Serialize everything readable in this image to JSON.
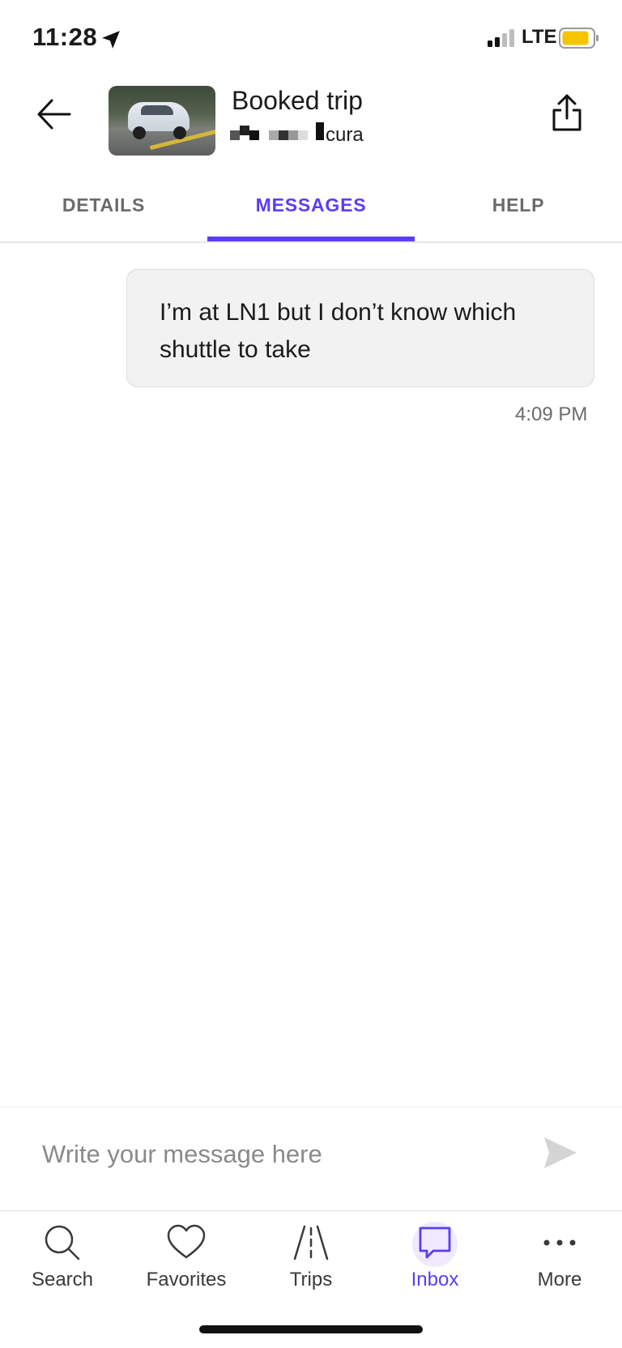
{
  "status_bar": {
    "time": "11:28",
    "network": "LTE",
    "battery_color": "#f5c400"
  },
  "header": {
    "title": "Booked trip",
    "subtitle_visible": "cura",
    "icons": {
      "back": "arrow-left-icon",
      "share": "share-icon"
    }
  },
  "tabs": [
    {
      "label": "DETAILS",
      "active": false
    },
    {
      "label": "MESSAGES",
      "active": true
    },
    {
      "label": "HELP",
      "active": false
    }
  ],
  "messages": [
    {
      "text": "I’m at LN1 but I don’t know which shuttle to take",
      "time": "4:09 PM",
      "sender": "me"
    }
  ],
  "composer": {
    "placeholder": "Write your message here",
    "value": ""
  },
  "nav": {
    "items": [
      {
        "label": "Search",
        "icon": "search-icon",
        "active": false
      },
      {
        "label": "Favorites",
        "icon": "heart-icon",
        "active": false
      },
      {
        "label": "Trips",
        "icon": "road-icon",
        "active": false
      },
      {
        "label": "Inbox",
        "icon": "chat-icon",
        "active": true
      },
      {
        "label": "More",
        "icon": "more-icon",
        "active": false
      }
    ]
  },
  "colors": {
    "accent": "#5b3df5",
    "bubble_bg": "#f2f2f2",
    "muted_text": "#6b6b6b"
  }
}
